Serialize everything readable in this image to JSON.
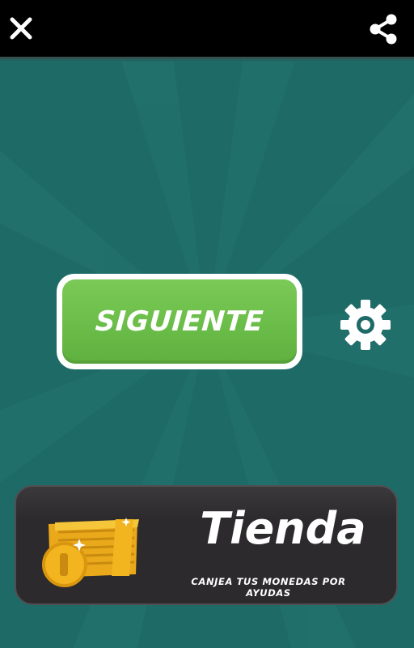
{
  "topbar": {
    "close_icon": "close-icon",
    "share_icon": "share-icon"
  },
  "main": {
    "next_button_label": "SIGUIENTE",
    "settings_icon": "gear-icon"
  },
  "shop": {
    "title": "Tienda",
    "subtitle": "CANJEA TUS MONEDAS POR AYUDAS",
    "icon": "treasure-chest-icon"
  },
  "colors": {
    "background": "#1d6a66",
    "topbar": "#000000",
    "next_button": "#6bbd49",
    "shop_banner": "#2c2a2c",
    "gold": "#f2b51f"
  }
}
